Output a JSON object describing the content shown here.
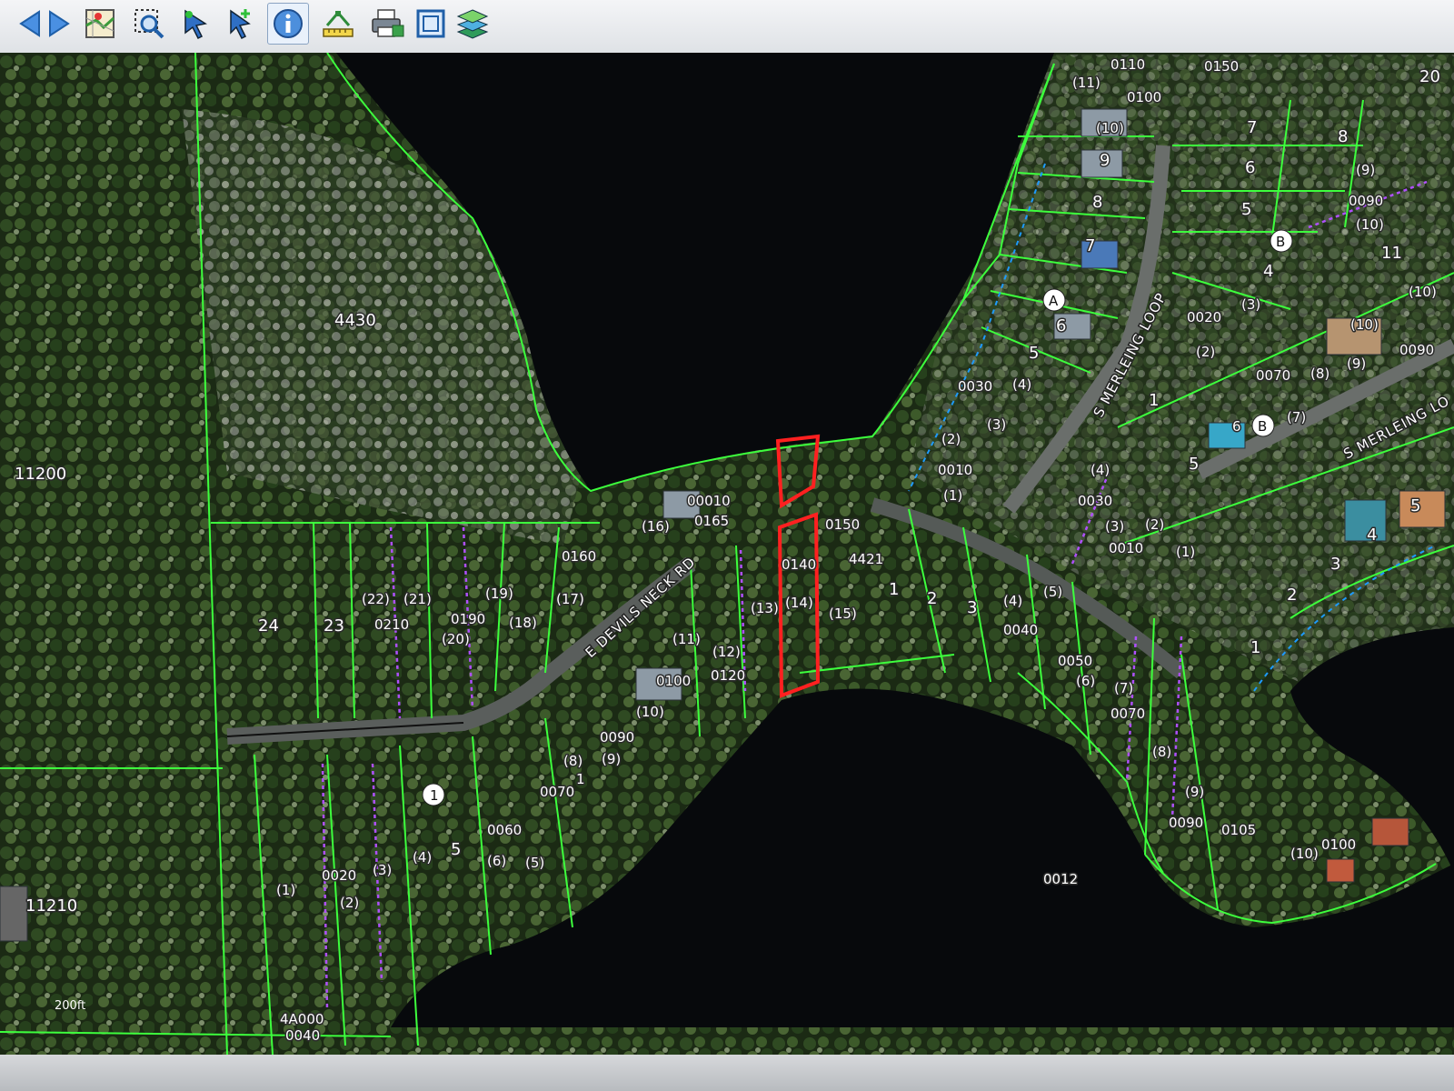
{
  "toolbar": {
    "buttons": [
      {
        "name": "back-arrow-icon"
      },
      {
        "name": "forward-arrow-icon"
      },
      {
        "name": "overview-map-icon"
      },
      {
        "name": "zoom-selection-icon"
      },
      {
        "name": "select-arrow-icon"
      },
      {
        "name": "select-add-icon"
      },
      {
        "name": "identify-info-icon",
        "active": true
      },
      {
        "name": "measure-icon"
      },
      {
        "name": "print-icon"
      },
      {
        "name": "full-extent-icon"
      },
      {
        "name": "layers-icon"
      }
    ]
  },
  "map": {
    "colors": {
      "parcel_line": "#3dff3d",
      "highlight": "#ff2020",
      "easement": "#b050ff",
      "water": "#07090c"
    },
    "road_labels": {
      "devils_neck": "E DEVILS NECK RD",
      "merleing_loop": "S MERLEING LOOP",
      "merleing_loop_east": "S MERLEING LO"
    },
    "scale_label": "200ft",
    "labels": {
      "l4430": "4430",
      "l11200": "11200",
      "l11210": "11210",
      "l0110": "0110",
      "l0150a": "0150",
      "l0100a": "0100",
      "p11": "(11)",
      "p10a": "(10)",
      "n20": "20",
      "n7a": "7",
      "n8a": "8",
      "n6a": "6",
      "n9": "9",
      "p9a": "(9)",
      "l0090a": "0090",
      "n5a": "5",
      "p10b": "(10)",
      "n8b": "8",
      "n7b": "7",
      "nB1": "B",
      "n4a": "4",
      "n11": "11",
      "p10c": "(10)",
      "nA": "A",
      "n6b": "6",
      "p3a": "(3)",
      "l0020a": "0020",
      "n5b": "5",
      "p2a": "(2)",
      "l0030a": "0030",
      "p4a": "(4)",
      "p10d": "(10)",
      "p9b": "(9)",
      "l0090b": "0090",
      "l0070a": "0070",
      "p8a": "(8)",
      "p3b": "(3)",
      "n1a": "1",
      "n6c": "6",
      "nB2": "B",
      "p7a": "(7)",
      "p2b": "(2)",
      "l0010a": "0010",
      "p1a": "(1)",
      "n5c": "5",
      "p4b": "(4)",
      "l0030b": "0030",
      "p3c": "(3)",
      "p2c": "(2)",
      "l0010b": "0010",
      "p1b": "(1)",
      "n5d": "5",
      "n4b": "4",
      "n3a": "3",
      "n2a": "2",
      "n1b": "1",
      "l00010": "00010",
      "l0165": "0165",
      "p16": "(16)",
      "l0150b": "0150",
      "l0140": "0140",
      "l4421": "4421",
      "l0160": "0160",
      "p14": "(14)",
      "p15": "(15)",
      "p13": "(13)",
      "n1c": "1",
      "n2b": "2",
      "n3b": "3",
      "p4c": "(4)",
      "p5a": "(5)",
      "l0040": "0040",
      "p17": "(17)",
      "p22": "(22)",
      "p21": "(21)",
      "p19": "(19)",
      "l0190": "0190",
      "p18": "(18)",
      "p20": "(20)",
      "n24": "24",
      "n23": "23",
      "l0210": "0210",
      "p11b": "(11)",
      "p12": "(12)",
      "l0100b": "0100",
      "l0120": "0120",
      "p10e": "(10)",
      "l0050": "0050",
      "p6a": "(6)",
      "p7b": "(7)",
      "l0070b": "0070",
      "p8b": "(8)",
      "l0090c": "0090",
      "p9c": "(9)",
      "p8c": "(8)",
      "l0070c": "0070",
      "n1d": "1",
      "n5e": "5",
      "l0060": "0060",
      "p4d": "(4)",
      "p6b": "(6)",
      "p5b": "(5)",
      "l0020b": "0020",
      "p3d": "(3)",
      "p1c": "(1)",
      "p2d": "(2)",
      "l0012": "0012",
      "l0090d": "0090",
      "l0105": "0105",
      "l0100c": "0100",
      "p10f": "(10)",
      "p9d": "(9)",
      "l4A000": "4A000",
      "l0040b": "0040",
      "n1e": "1"
    }
  }
}
